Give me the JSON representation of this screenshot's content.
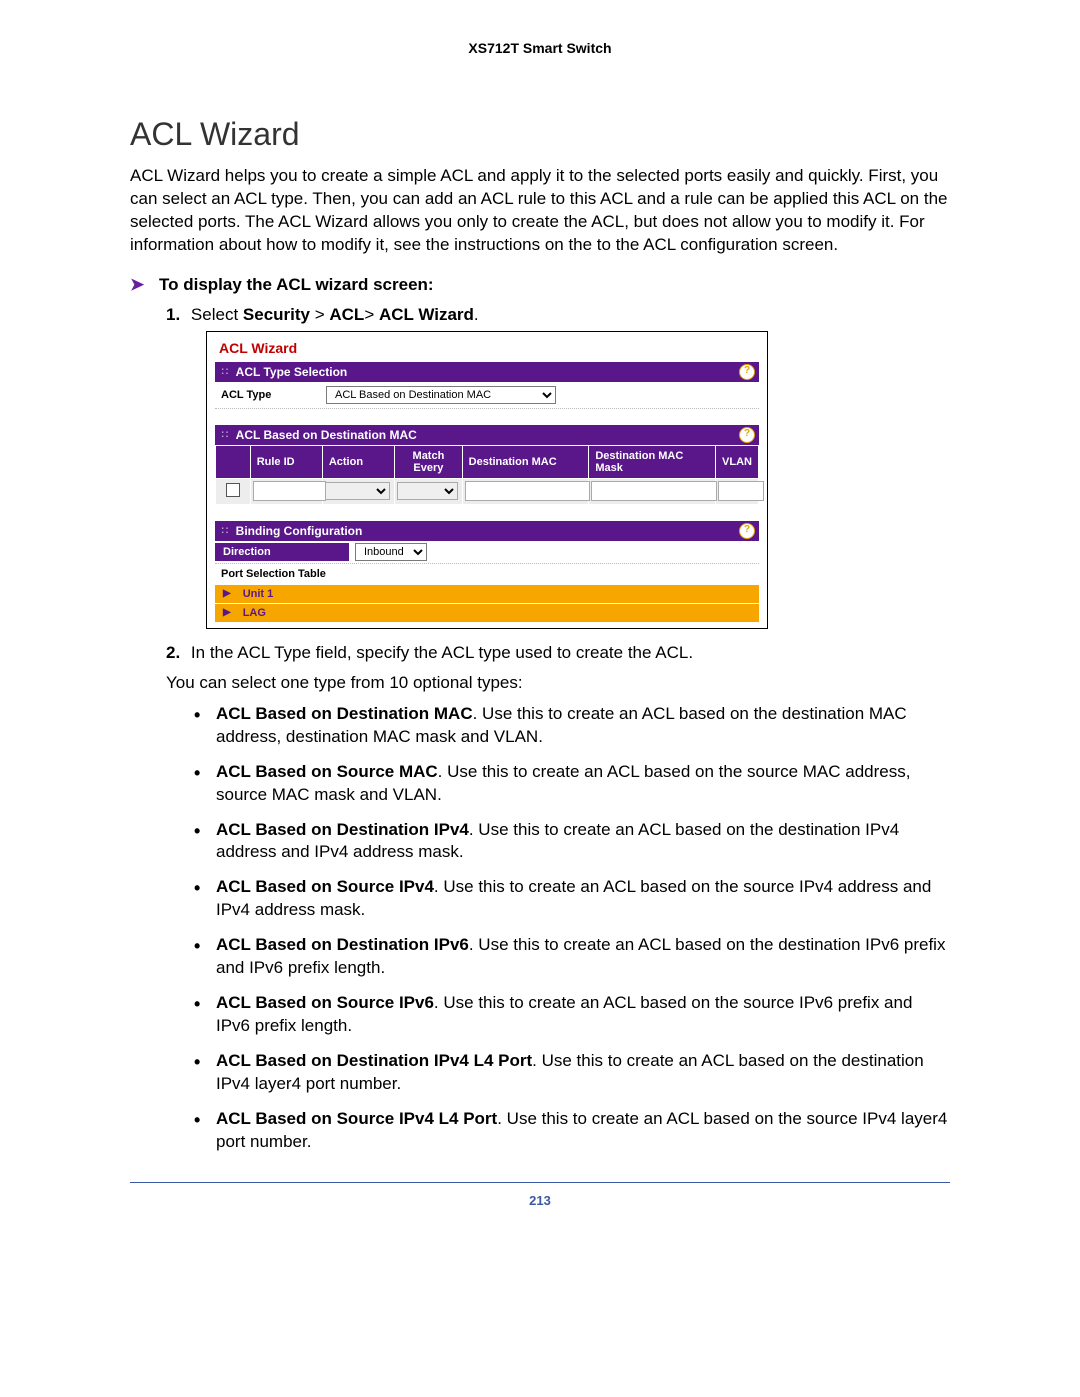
{
  "header": "XS712T Smart Switch",
  "title": "ACL Wizard",
  "intro": "ACL Wizard helps you to create a simple ACL and apply it to the selected ports easily and quickly. First, you can select an ACL type. Then, you can add an ACL rule to this ACL and a rule can be applied this ACL on the selected ports. The ACL Wizard allows you only to create the ACL, but does not allow you to modify it. For information about how to modify it, see the instructions on the to the ACL configuration screen.",
  "procHeader": "To display the ACL wizard screen:",
  "steps": {
    "one_num": "1.",
    "one_pre": "Select ",
    "one_b1": "Security",
    "one_gt1": " > ",
    "one_b2": "ACL",
    "one_gt2": "> ",
    "one_b3": "ACL Wizard",
    "one_post": ".",
    "two_num": "2.",
    "two_text": "In the ACL Type field, specify the ACL type used to create the ACL.",
    "two_sub": "You can select one type from 10 optional types:"
  },
  "bullets": [
    {
      "b": "ACL Based on Destination MAC",
      "t": ". Use this to create an ACL based on the destination MAC address, destination MAC mask and VLAN."
    },
    {
      "b": "ACL Based on Source MAC",
      "t": ". Use this to create an ACL based on the source MAC address, source MAC mask and VLAN."
    },
    {
      "b": "ACL Based on Destination IPv4",
      "t": ". Use this to create an ACL based on the destination IPv4 address and IPv4 address mask."
    },
    {
      "b": "ACL Based on Source IPv4",
      "t": ". Use this to create an ACL based on the source IPv4 address and IPv4 address mask."
    },
    {
      "b": "ACL Based on Destination IPv6",
      "t": ". Use this to create an ACL based on the destination IPv6 prefix and IPv6 prefix length."
    },
    {
      "b": "ACL Based on Source IPv6",
      "t": ". Use this to create an ACL based on the source IPv6 prefix and IPv6 prefix length."
    },
    {
      "b": "ACL Based on Destination IPv4 L4 Port",
      "t": ". Use this to create an ACL based on the destination IPv4 layer4 port number."
    },
    {
      "b": "ACL Based on Source IPv4 L4 Port",
      "t": ". Use this to create an ACL based on the source IPv4 layer4 port number."
    }
  ],
  "shot": {
    "panelTitle": "ACL Wizard",
    "sec1": "ACL Type Selection",
    "aclTypeLabel": "ACL Type",
    "aclTypeValue": "ACL Based on Destination MAC",
    "sec2": "ACL Based on Destination MAC",
    "cols": {
      "c0": "",
      "c1": "Rule ID",
      "c2": "Action",
      "c3": "Match Every",
      "c4": "Destination MAC",
      "c5": "Destination MAC Mask",
      "c6": "VLAN"
    },
    "sec3": "Binding Configuration",
    "dirLabel": "Direction",
    "dirValue": "Inbound",
    "pst": "Port Selection Table",
    "unit1": "Unit 1",
    "lag": "LAG",
    "help": "?"
  },
  "pageNumber": "213"
}
